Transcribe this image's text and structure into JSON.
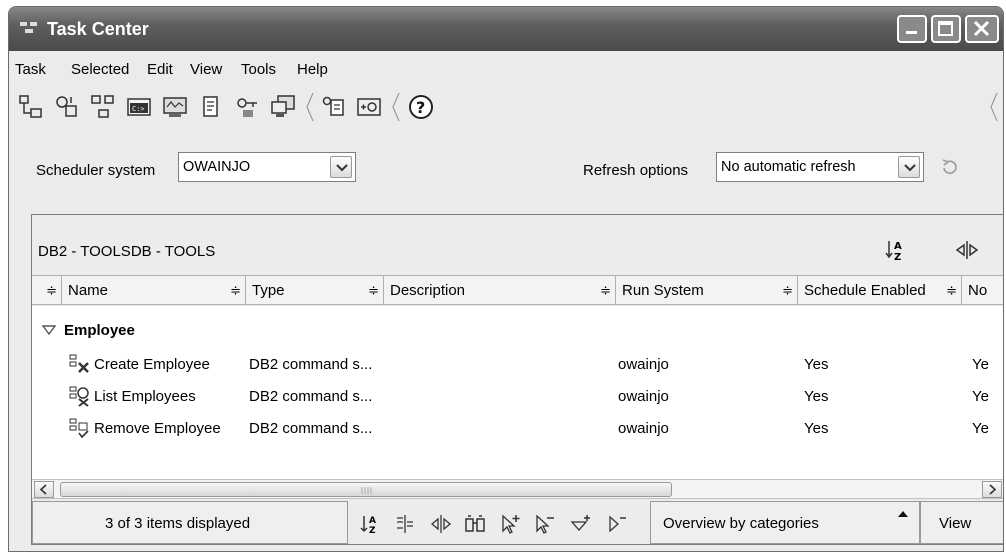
{
  "window": {
    "title": "Task Center"
  },
  "menu": [
    "Task",
    "Selected",
    "Edit",
    "View",
    "Tools",
    "Help"
  ],
  "toolbar": {
    "icons": [
      "new-task-icon",
      "task-tool-icon",
      "group-tasks-icon",
      "command-window-icon",
      "control-center-icon",
      "journal-icon",
      "license-center-icon",
      "configuration-assistant-icon",
      "notification-icon",
      "settings-icon",
      "help-icon"
    ]
  },
  "scheduler": {
    "label": "Scheduler system",
    "value": "OWAINJO"
  },
  "refresh": {
    "label": "Refresh options",
    "value": "No automatic refresh"
  },
  "panel": {
    "path": "DB2 - TOOLSDB - TOOLS"
  },
  "columns": [
    "Name",
    "Type",
    "Description",
    "Run System",
    "Schedule Enabled",
    "No"
  ],
  "group": {
    "name": "Employee"
  },
  "rows": [
    {
      "name": "Create Employee",
      "type": "DB2 command s...",
      "description": "",
      "run_system": "owainjo",
      "schedule_enabled": "Yes",
      "next": "Ye"
    },
    {
      "name": "List Employees",
      "type": "DB2 command s...",
      "description": "",
      "run_system": "owainjo",
      "schedule_enabled": "Yes",
      "next": "Ye"
    },
    {
      "name": "Remove Employee",
      "type": "DB2 command s...",
      "description": "",
      "run_system": "owainjo",
      "schedule_enabled": "Yes",
      "next": "Ye"
    }
  ],
  "status": {
    "count_text": "3 of 3 items displayed",
    "view_mode": "Overview by categories",
    "view_label": "View"
  }
}
